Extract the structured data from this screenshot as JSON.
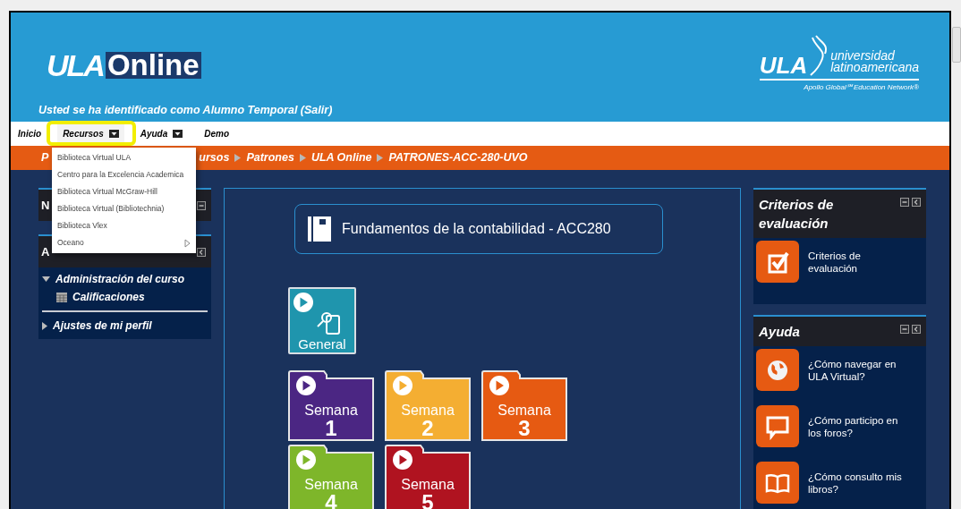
{
  "header": {
    "logo_left": "ULA",
    "logo_online": "Online",
    "logo_right": "ULA",
    "university_lines": [
      "universidad",
      "latinoamericana"
    ],
    "tagline": "Apollo Global℠ Education Network®",
    "user_line": "Usted se ha identificado como Alumno Temporal (Salir)"
  },
  "nav": [
    {
      "label": "Inicio",
      "has_menu": false,
      "selected": false
    },
    {
      "label": "Recursos",
      "has_menu": true,
      "selected": true
    },
    {
      "label": "Ayuda",
      "has_menu": true,
      "selected": false
    },
    {
      "label": "Demo",
      "has_menu": false,
      "selected": false
    }
  ],
  "breadcrumb": {
    "lead": "P",
    "items": [
      "ursos",
      "Patrones",
      "ULA Online",
      "PATRONES-ACC-280-UVO"
    ]
  },
  "dropdown": [
    {
      "label": "Biblioteca Virtual ULA",
      "submenu": false
    },
    {
      "label": "Centro para la Excelencia Academica",
      "submenu": false
    },
    {
      "label": "Biblioteca Virtual McGraw-Hill",
      "submenu": false
    },
    {
      "label": "Biblioteca Virtual (Bibliotechnia)",
      "submenu": false
    },
    {
      "label": "Biblioteca Vlex",
      "submenu": false
    },
    {
      "label": "Oceano",
      "submenu": true
    }
  ],
  "left_blocks": [
    {
      "title": "N"
    },
    {
      "title": "A",
      "tree": [
        {
          "label": "Administración del curso",
          "expanded": true,
          "children": [
            {
              "label": "Calificaciones"
            }
          ]
        },
        {
          "label": "Ajustes de mi perfil",
          "expanded": false
        }
      ]
    }
  ],
  "course_title": "Fundamentos de la contabilidad - ACC280",
  "sections": [
    {
      "kind": "general",
      "label": "General",
      "color": "#1f95ad"
    },
    {
      "kind": "week",
      "label": "Semana",
      "number": "1",
      "color": "#4b2683"
    },
    {
      "kind": "week",
      "label": "Semana",
      "number": "2",
      "color": "#f4ae32"
    },
    {
      "kind": "week",
      "label": "Semana",
      "number": "3",
      "color": "#e65a12"
    },
    {
      "kind": "week",
      "label": "Semana",
      "number": "4",
      "color": "#7eb62a"
    },
    {
      "kind": "week",
      "label": "Semana",
      "number": "5",
      "color": "#b01320"
    }
  ],
  "right_blocks": [
    {
      "title": "Criterios de evaluación",
      "links": [
        {
          "kind": "check",
          "label": "Criterios de evaluación"
        }
      ]
    },
    {
      "title": "Ayuda",
      "links": [
        {
          "kind": "globe",
          "label": "¿Cómo navegar en ULA Virtual?"
        },
        {
          "kind": "chat",
          "label": "¿Cómo participo en los foros?"
        },
        {
          "kind": "book",
          "label": "¿Cómo consulto mis libros?"
        }
      ]
    }
  ]
}
